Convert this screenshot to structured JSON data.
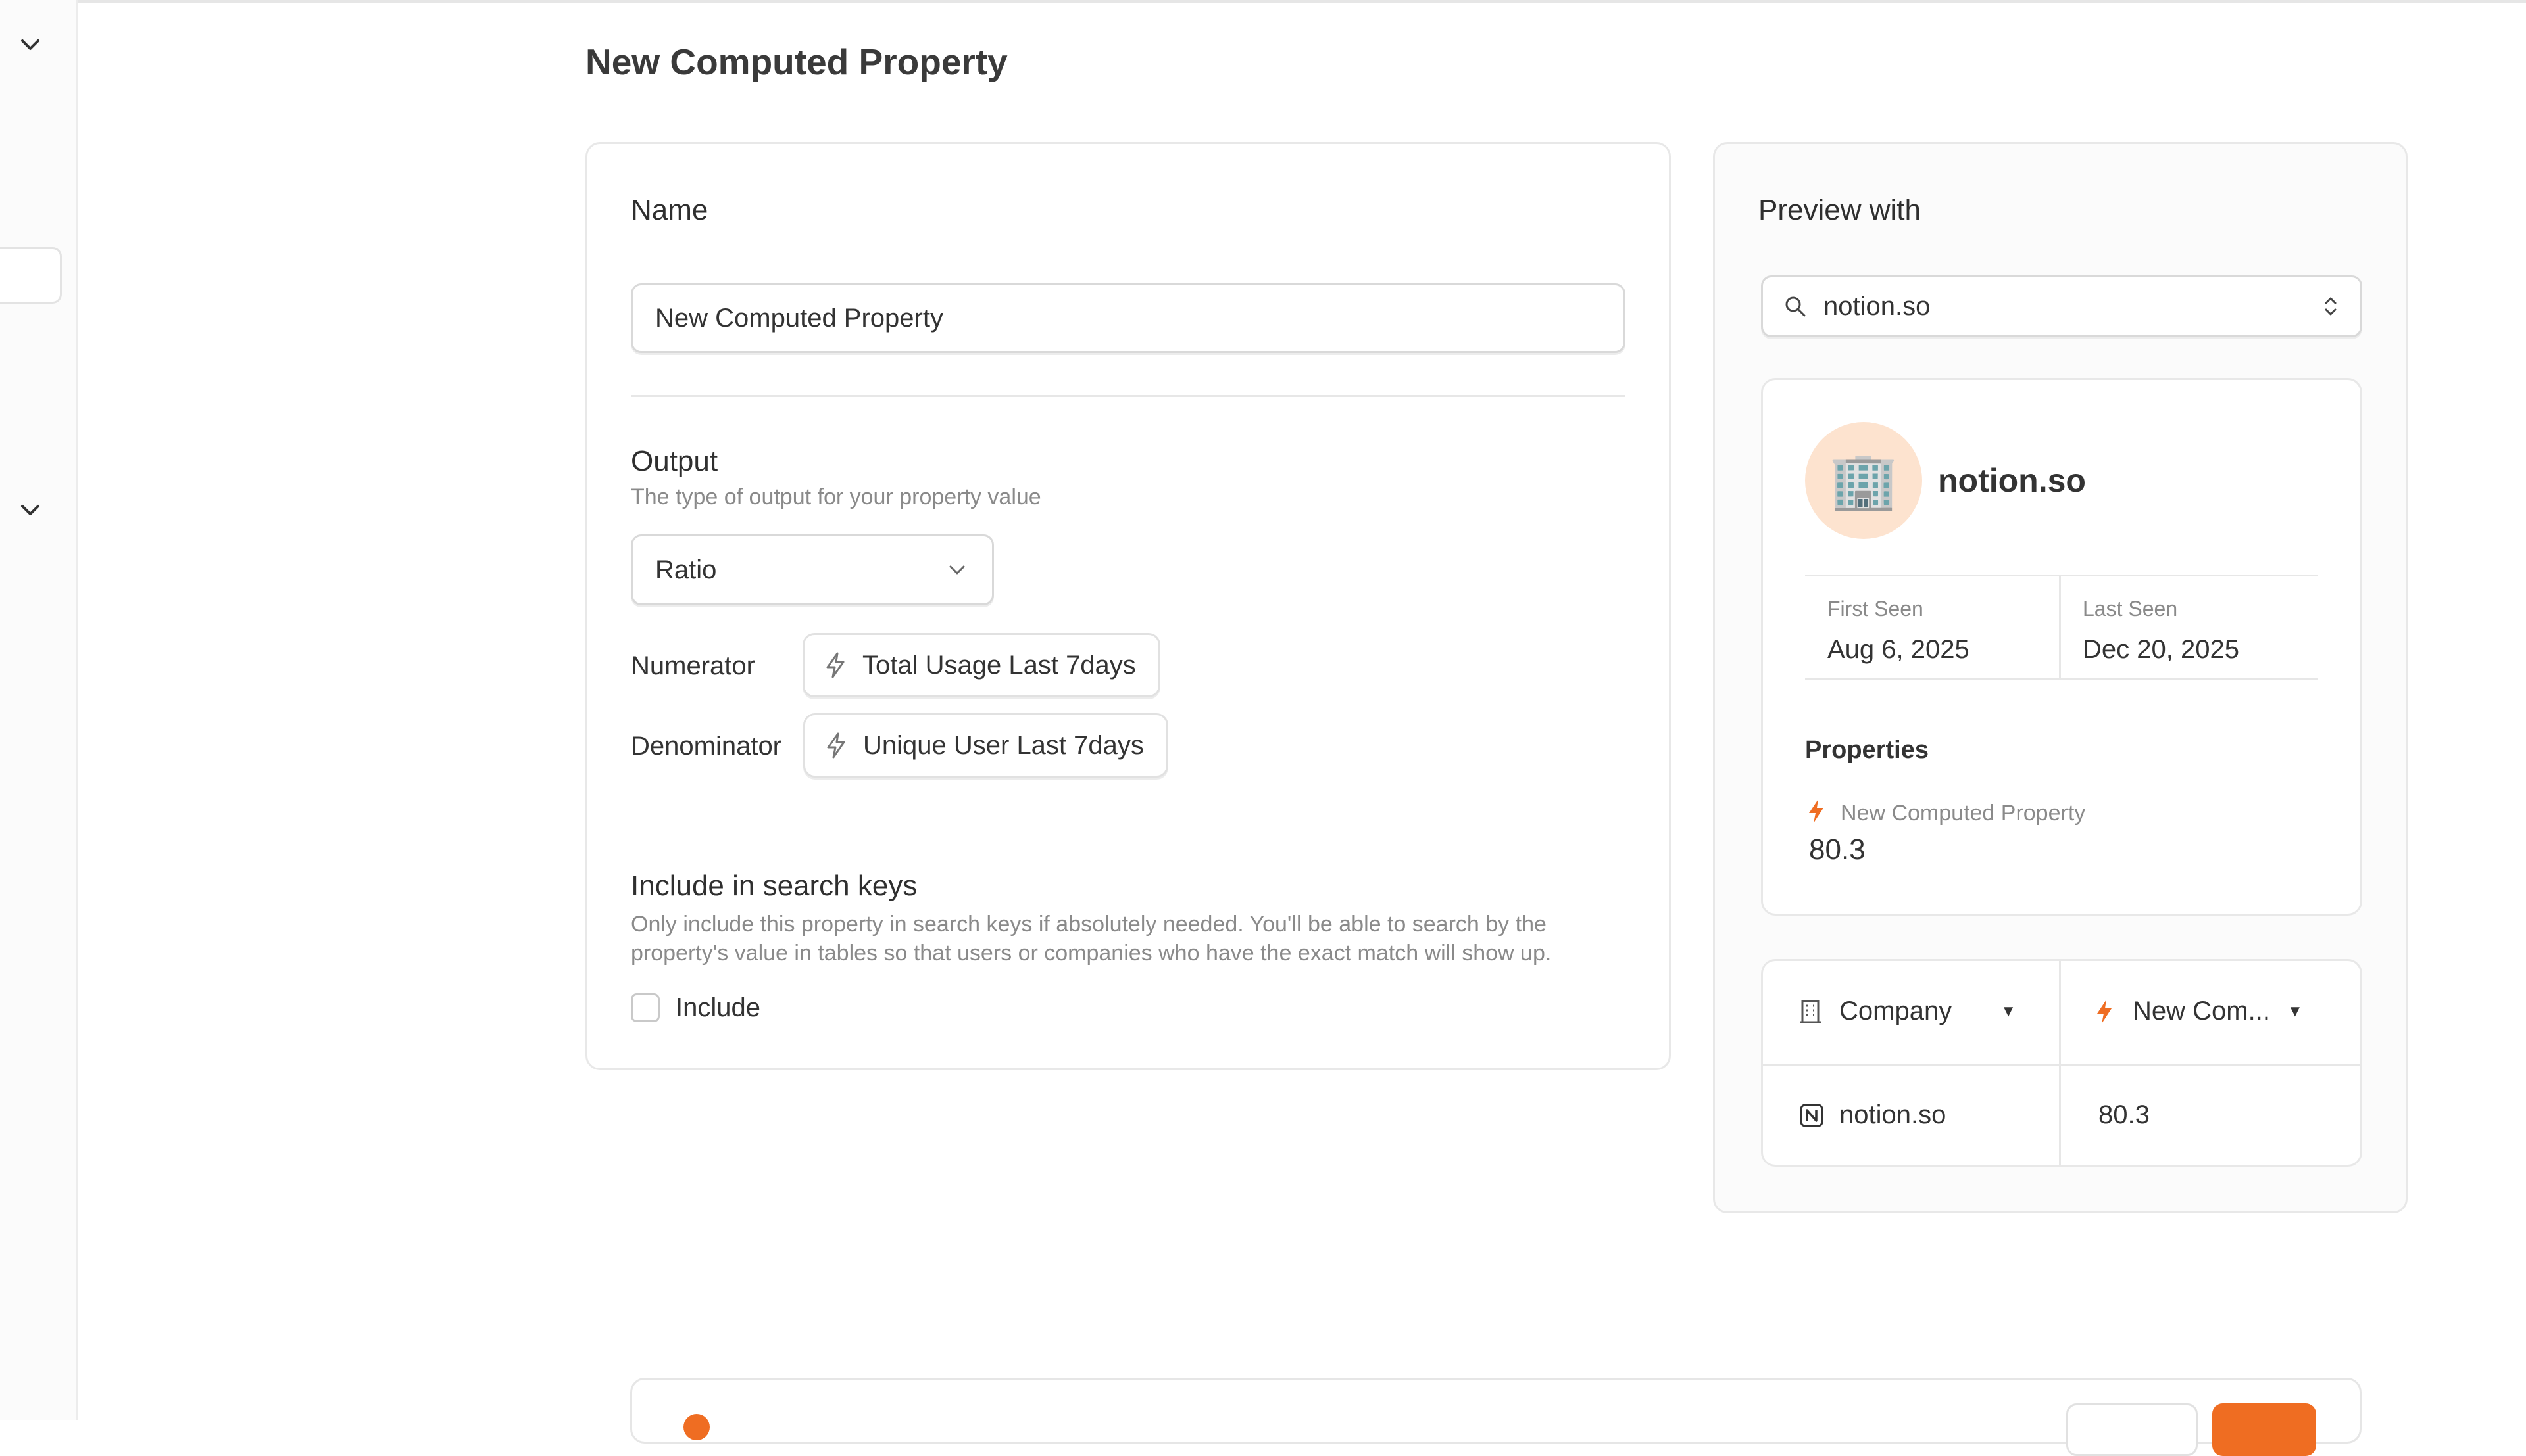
{
  "page": {
    "title": "New Computed Property"
  },
  "form": {
    "name_label": "Name",
    "name_value": "New Computed Property",
    "output_label": "Output",
    "output_hint": "The type of output for your property value",
    "output_type": "Ratio",
    "numerator_label": "Numerator",
    "numerator_value": "Total Usage Last 7days",
    "denominator_label": "Denominator",
    "denominator_value": "Unique User Last 7days",
    "search_keys_title": "Include in search keys",
    "search_keys_hint_1": "Only include this property in search keys if absolutely needed. You'll be able to search by the",
    "search_keys_hint_2": "property's value in tables so that users or companies who have the exact match will show up.",
    "include_label": "Include"
  },
  "preview": {
    "title": "Preview with",
    "search_value": "notion.so",
    "entity_name": "notion.so",
    "entity_emoji": "🏢",
    "first_seen_label": "First Seen",
    "first_seen_value": "Aug 6, 2025",
    "last_seen_label": "Last Seen",
    "last_seen_value": "Dec 20, 2025",
    "properties_label": "Properties",
    "property_name": "New Computed Property",
    "property_value": "80.3",
    "table": {
      "col1": "Company",
      "col2": "New Com...",
      "row_company": "notion.so",
      "row_value": "80.3"
    }
  },
  "colors": {
    "accent": "#ef6d22",
    "avatar_bg": "#fde3cf"
  },
  "icons": {
    "sidebar_chevron": "chevron-down-icon",
    "bolt": "lightning-icon",
    "search": "search-icon",
    "sort": "up-down-chevron-icon",
    "building": "building-icon",
    "notion": "notion-logo-icon"
  }
}
